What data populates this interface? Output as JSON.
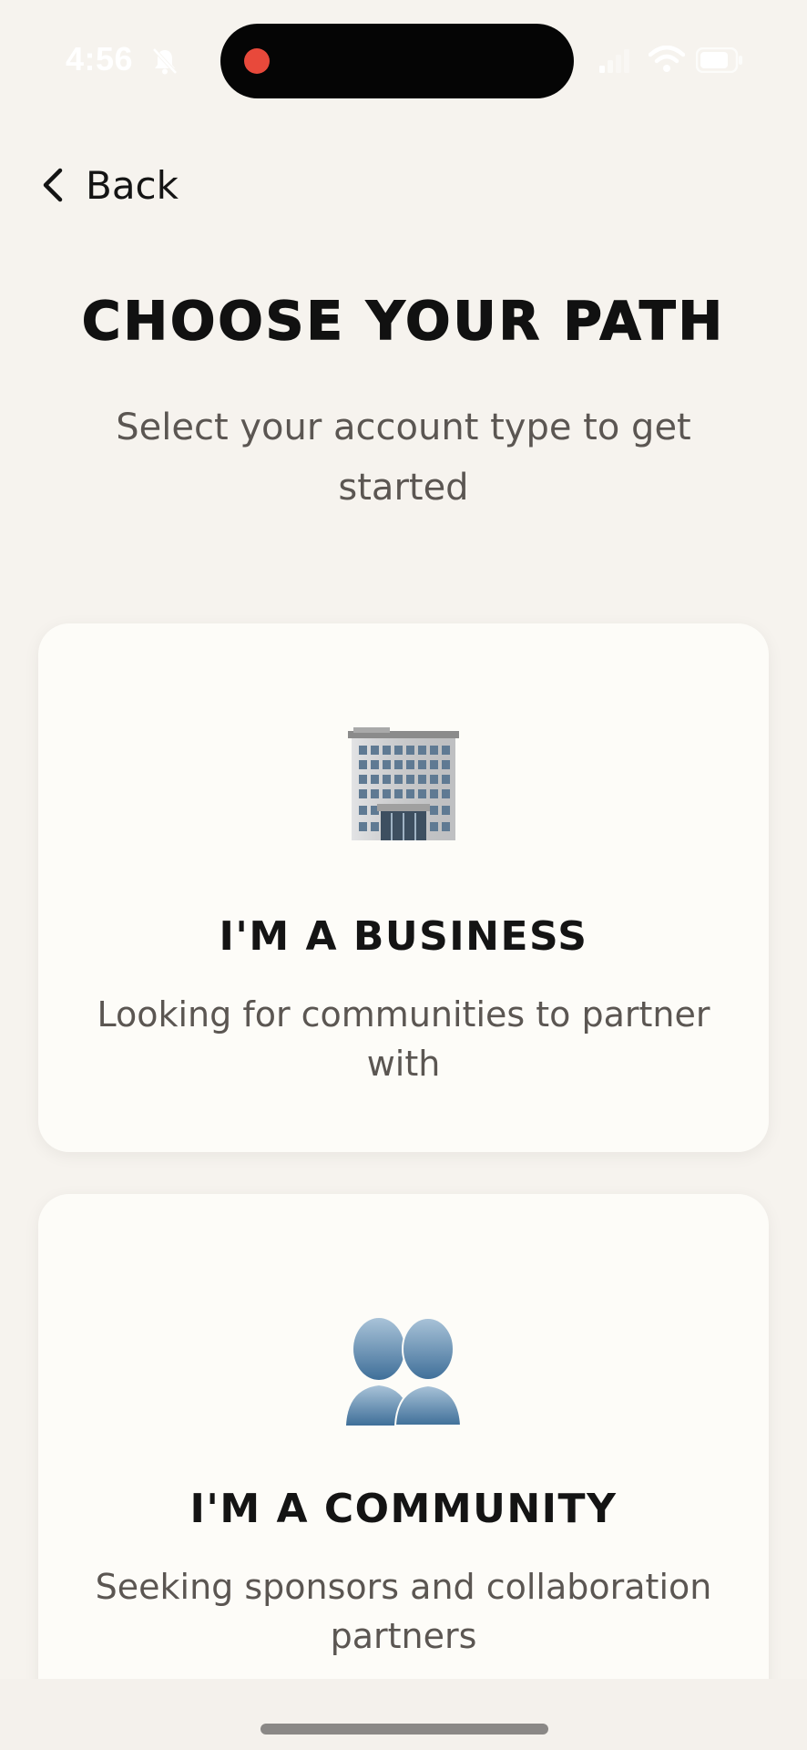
{
  "status_bar": {
    "time": "4:56"
  },
  "nav": {
    "back_label": "Back"
  },
  "header": {
    "title": "CHOOSE YOUR PATH",
    "subtitle": "Select your account type to get started"
  },
  "options": [
    {
      "icon": "office-building-icon",
      "title": "I'M A BUSINESS",
      "description": "Looking for communities to partner with"
    },
    {
      "icon": "people-silhouette-icon",
      "title": "I'M A COMMUNITY",
      "description": "Seeking sponsors and collaboration partners"
    }
  ],
  "colors": {
    "background": "#f6f3ee",
    "card": "#fdfcf8",
    "title_text": "#111111",
    "secondary_text": "#5b5652",
    "record_dot": "#e8493b"
  }
}
